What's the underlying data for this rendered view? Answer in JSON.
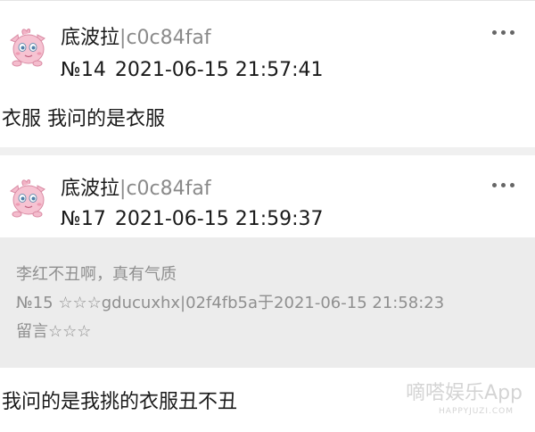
{
  "posts": [
    {
      "author": {
        "name": "底波拉",
        "separator": "|",
        "hash": "c0c84faf"
      },
      "post_number": "№14",
      "timestamp": "2021-06-15 21:57:41",
      "body": "衣服 我问的是衣服"
    },
    {
      "author": {
        "name": "底波拉",
        "separator": "|",
        "hash": "c0c84faf"
      },
      "post_number": "№17",
      "timestamp": "2021-06-15 21:59:37",
      "quote": {
        "text": "李红不丑啊，真有气质",
        "meta": "№15 ☆☆☆gducuxhx|02f4fb5a于2021-06-15 21:58:23",
        "suffix": "留言☆☆☆"
      },
      "body": "我问的是我挑的衣服丑不丑"
    }
  ],
  "watermark": {
    "cn": "嘀嗒娱乐App",
    "en": "HAPPYJUZI.COM"
  },
  "icons": {
    "avatar": "pink-puffball-avatar-icon",
    "more": "more-dots-icon"
  },
  "colors": {
    "card_bg": "#ffffff",
    "page_bg": "#f0f0f0",
    "quote_bg": "#ececec",
    "hash_gray": "#8a8a8a",
    "quote_text": "#8f8f8f"
  }
}
